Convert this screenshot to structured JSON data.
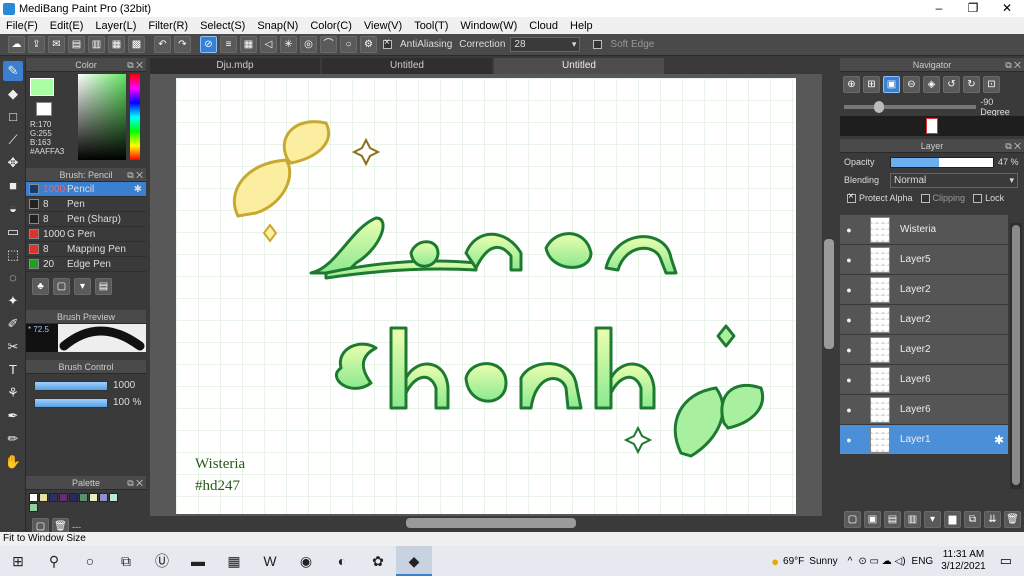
{
  "window": {
    "title": "MediBang Paint Pro (32bit)"
  },
  "menu": [
    "File(F)",
    "Edit(E)",
    "Layer(L)",
    "Filter(R)",
    "Select(S)",
    "Snap(N)",
    "Color(C)",
    "View(V)",
    "Tool(T)",
    "Window(W)",
    "Cloud",
    "Help"
  ],
  "toolbar": {
    "antialiasing": "AntiAliasing",
    "correction_label": "Correction",
    "correction_value": "28",
    "soft_edge": "Soft Edge"
  },
  "color_panel": {
    "title": "Color",
    "r": "R:170",
    "g": "G:255",
    "b": "B:163",
    "hex": "#AAFFA3",
    "fg": "#AAFFA3"
  },
  "brush_panel": {
    "title": "Brush: Pencil",
    "items": [
      {
        "size": "1000",
        "name": "Pencil",
        "color": "#1a3a6a"
      },
      {
        "size": "8",
        "name": "Pen",
        "color": "#222222"
      },
      {
        "size": "8",
        "name": "Pen (Sharp)",
        "color": "#222222"
      },
      {
        "size": "1000",
        "name": "G Pen",
        "color": "#e03030"
      },
      {
        "size": "8",
        "name": "Mapping Pen",
        "color": "#e03030"
      },
      {
        "size": "20",
        "name": "Edge Pen",
        "color": "#20a020"
      }
    ]
  },
  "brush_preview": {
    "title": "Brush Preview",
    "size": "* 72.5"
  },
  "brush_control": {
    "title": "Brush Control",
    "size_value": "1000",
    "opacity_value": "100 %"
  },
  "palette": {
    "title": "Palette",
    "colors": [
      "#ffffff",
      "#e8e0a0",
      "#303060",
      "#603070",
      "#2a2a5a",
      "#5a9070",
      "#e8f0c0",
      "#9090d0",
      "#c0e8d0",
      "#90d0a0"
    ],
    "footer": "---"
  },
  "doc_tabs": [
    "Dju.mdp",
    "Untitled",
    "Untitled"
  ],
  "canvas": {
    "signature_name": "Wisteria",
    "signature_tag": "#hd247"
  },
  "navigator": {
    "title": "Navigator",
    "angle": "-90 Degree"
  },
  "layer_panel": {
    "title": "Layer",
    "opacity_label": "Opacity",
    "opacity_value": "47 %",
    "opacity_fraction": 0.47,
    "blending_label": "Blending",
    "blending_value": "Normal",
    "protect_alpha": "Protect Alpha",
    "clipping": "Clipping",
    "lock": "Lock",
    "layers": [
      "Wisteria",
      "Layer5",
      "Layer2",
      "Layer2",
      "Layer2",
      "Layer6",
      "Layer6",
      "Layer1"
    ]
  },
  "status": {
    "text": "Fit to Window Size"
  },
  "taskbar": {
    "weather_temp": "69°F",
    "weather_desc": "Sunny",
    "lang": "ENG",
    "time": "11:31 AM",
    "date": "3/12/2021"
  }
}
